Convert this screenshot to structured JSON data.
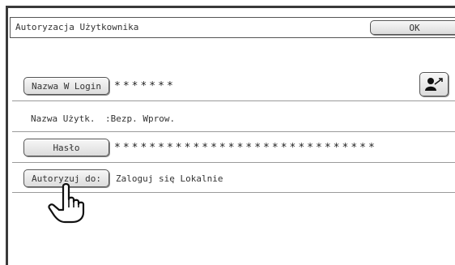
{
  "dialog": {
    "title": "Autoryzacja Użytkownika",
    "ok_label": "OK"
  },
  "login": {
    "button_label": "Nazwa W Login",
    "value": "*******",
    "user_icon": "user-select-icon"
  },
  "username": {
    "label": "Nazwa Użytk.",
    "value": ":Bezp. Wprow."
  },
  "password": {
    "button_label": "Hasło",
    "value": "******************************"
  },
  "auth": {
    "button_label": "Autoryzuj do:",
    "value": "Zaloguj się Lokalnie"
  },
  "pointer_icon": "hand-pointer-icon"
}
